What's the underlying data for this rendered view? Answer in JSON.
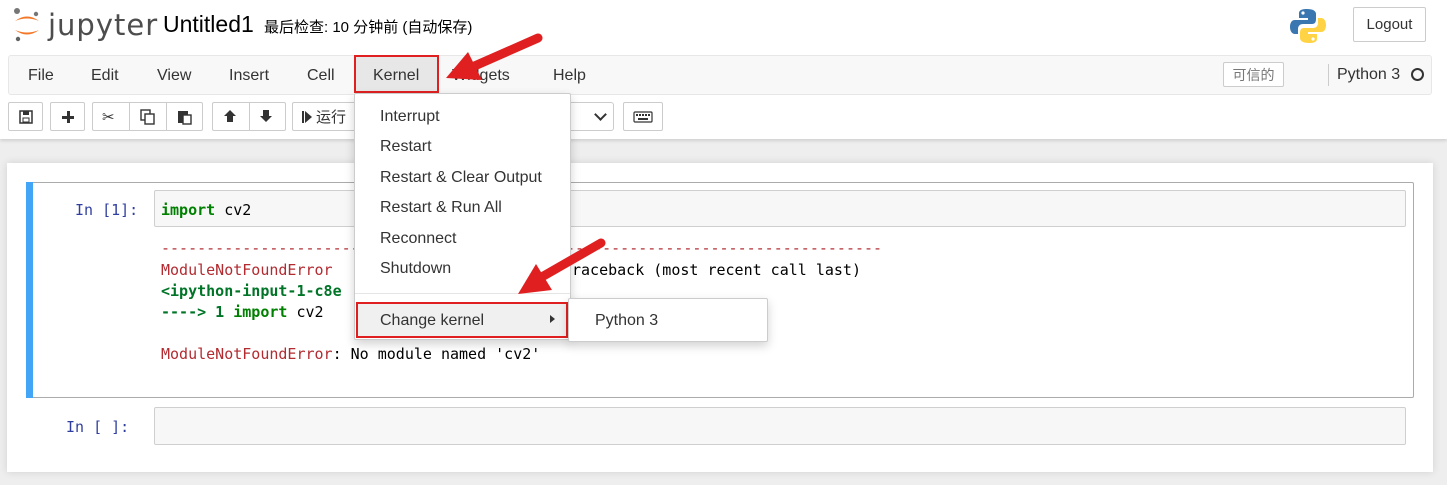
{
  "header": {
    "logo_text": "jupyter",
    "notebook_name": "Untitled1",
    "checkpoint": "最后检查: 10 分钟前  (自动保存)",
    "logout": "Logout"
  },
  "menubar": {
    "items": [
      "File",
      "Edit",
      "View",
      "Insert",
      "Cell",
      "Kernel",
      "Widgets",
      "Help"
    ],
    "trusted": "可信的",
    "kernel_name": "Python 3"
  },
  "toolbar": {
    "run_label": "运行"
  },
  "kernel_menu": {
    "items": [
      "Interrupt",
      "Restart",
      "Restart & Clear Output",
      "Restart & Run All",
      "Reconnect",
      "Shutdown"
    ],
    "change_kernel": "Change kernel",
    "submenu": [
      "Python 3"
    ]
  },
  "cells": [
    {
      "prompt": "In  [1]:",
      "input_keyword": "import",
      "input_rest": " cv2",
      "output": {
        "dashes_left": "----------------------------------------",
        "dashes_right": "-----------------------------------",
        "err_name": "ModuleNotFoundError",
        "traceback_tail": "raceback (most recent call last)",
        "ipython_input": "<ipython-input-1-c8e",
        "arrow_line_prefix": "----> 1 ",
        "arrow_line_kw": "import",
        "arrow_line_rest": " cv2",
        "final_err_name": "ModuleNotFoundError",
        "final_err_msg": ": No module named 'cv2'"
      }
    },
    {
      "prompt": "In  [ ]:"
    }
  ],
  "colors": {
    "annotation_red": "#e02020",
    "selected_cell_bar": "#42a5f5",
    "prompt_blue": "#303f9f",
    "error_red": "#b22b31",
    "keyword_green": "#008000"
  }
}
